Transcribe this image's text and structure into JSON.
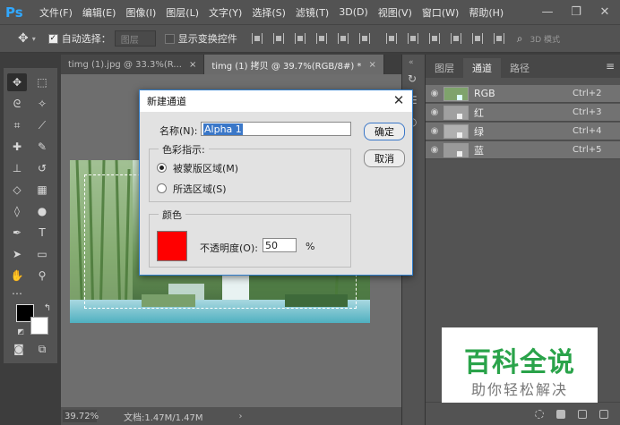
{
  "app": {
    "logo": "Ps",
    "menu": [
      "文件(F)",
      "编辑(E)",
      "图像(I)",
      "图层(L)",
      "文字(Y)",
      "选择(S)",
      "滤镜(T)",
      "3D(D)",
      "视图(V)",
      "窗口(W)",
      "帮助(H)"
    ],
    "window_controls": {
      "minimize": "—",
      "restore": "❐",
      "close": "✕"
    }
  },
  "options": {
    "auto_select_label": "自动选择：",
    "auto_select_value": "图层",
    "show_transform_label": "显示变换控件",
    "mode_3d": "3D 模式"
  },
  "tabs": [
    {
      "label": "timg (1).jpg @ 33.3%(R...",
      "close": "×"
    },
    {
      "label": "timg (1) 拷贝 @ 39.7%(RGB/8#) *",
      "close": "×"
    }
  ],
  "status": {
    "zoom": "39.72%",
    "doc": "文档:1.47M/1.47M"
  },
  "panel": {
    "tabs": [
      "图层",
      "通道",
      "路径"
    ],
    "menu_icon": "≡",
    "channels": [
      {
        "name": "RGB",
        "shortcut": "Ctrl+2"
      },
      {
        "name": "红",
        "shortcut": "Ctrl+3"
      },
      {
        "name": "绿",
        "shortcut": "Ctrl+4"
      },
      {
        "name": "蓝",
        "shortcut": "Ctrl+5"
      }
    ]
  },
  "dialog": {
    "title": "新建通道",
    "name_label": "名称(N):",
    "name_value": "Alpha 1",
    "color_indicates_label": "色彩指示:",
    "radio_masked": "被蒙版区域(M)",
    "radio_selected": "所选区域(S)",
    "color_group_label": "颜色",
    "opacity_label": "不透明度(O):",
    "opacity_value": "50",
    "opacity_unit": "%",
    "ok": "确定",
    "cancel": "取消",
    "swatch_color": "#ff0000"
  },
  "watermark": {
    "main": "百科全说",
    "sub": "助你轻松解决"
  }
}
